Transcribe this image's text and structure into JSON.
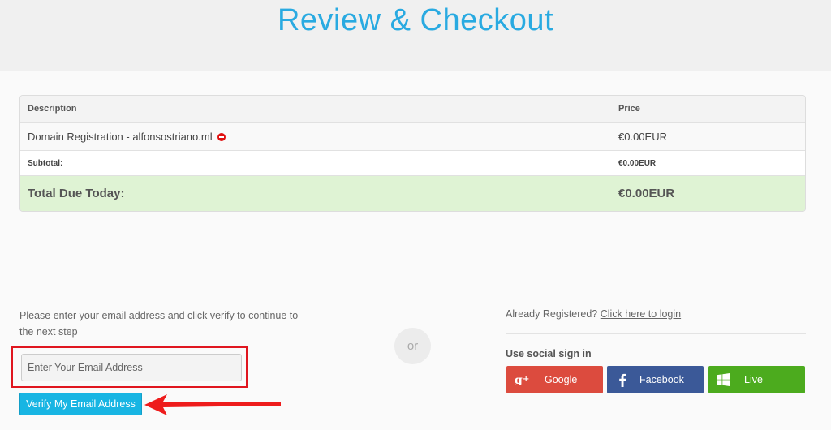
{
  "page": {
    "title": "Review & Checkout"
  },
  "cart": {
    "headers": {
      "description": "Description",
      "price": "Price"
    },
    "items": [
      {
        "description": "Domain Registration - alfonsostriano.ml",
        "price": "€0.00EUR"
      }
    ],
    "subtotal": {
      "label": "Subtotal:",
      "value": "€0.00EUR"
    },
    "total": {
      "label": "Total Due Today:",
      "value": "€0.00EUR"
    }
  },
  "email_section": {
    "prompt": "Please enter your email address and click verify to continue to the next step",
    "placeholder": "Enter Your Email Address",
    "verify_label": "Verify My Email Address"
  },
  "separator": {
    "label": "or"
  },
  "login_section": {
    "already_text": "Already Registered?",
    "login_link": "Click here to login",
    "social_title": "Use social sign in",
    "buttons": [
      {
        "label": "Google",
        "icon": "google-plus-icon",
        "color": "#dc4b3e"
      },
      {
        "label": "Facebook",
        "icon": "facebook-icon",
        "color": "#3b5998"
      },
      {
        "label": "Live",
        "icon": "windows-icon",
        "color": "#4cab1e"
      }
    ]
  },
  "colors": {
    "accent": "#29aae1",
    "verify": "#18b5e3",
    "highlight": "#e0161f",
    "total_bg": "#dff3d4"
  }
}
